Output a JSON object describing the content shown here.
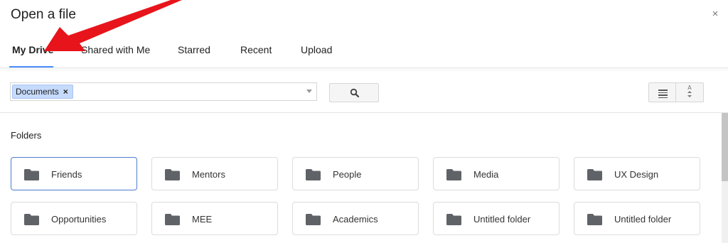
{
  "dialog": {
    "title": "Open a file",
    "close_glyph": "×"
  },
  "tabs": [
    {
      "label": "My Drive",
      "active": true
    },
    {
      "label": "Shared with Me",
      "active": false
    },
    {
      "label": "Starred",
      "active": false
    },
    {
      "label": "Recent",
      "active": false
    },
    {
      "label": "Upload",
      "active": false
    }
  ],
  "search": {
    "chip_label": "Documents",
    "chip_remove": "×",
    "input_value": ""
  },
  "toolbar": {
    "sort_glyph": "A\nZ"
  },
  "folders_section": {
    "label": "Folders",
    "items": [
      {
        "name": "Friends",
        "selected": true
      },
      {
        "name": "Mentors",
        "selected": false
      },
      {
        "name": "People",
        "selected": false
      },
      {
        "name": "Media",
        "selected": false
      },
      {
        "name": "UX Design",
        "selected": false
      },
      {
        "name": "Opportunities",
        "selected": false
      },
      {
        "name": "MEE",
        "selected": false
      },
      {
        "name": "Academics",
        "selected": false
      },
      {
        "name": "Untitled folder",
        "selected": false
      },
      {
        "name": "Untitled folder",
        "selected": false
      }
    ]
  },
  "colors": {
    "accent": "#4d90fe",
    "chip_bg": "#c6dafc",
    "folder_icon": "#5f6368",
    "annotation_arrow": "#e8141b"
  },
  "icons": {
    "close": "close-icon",
    "search": "search-icon",
    "list_view": "list-view-icon",
    "sort": "sort-az-icon",
    "folder": "folder-icon",
    "annotation": "red-arrow-annotation"
  }
}
